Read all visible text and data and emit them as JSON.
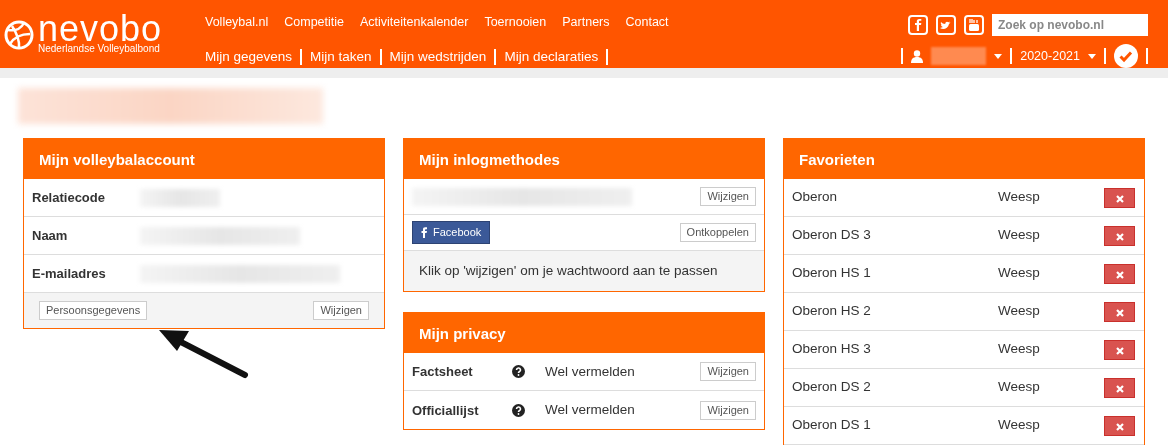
{
  "header": {
    "logo": {
      "name": "nevobo",
      "tagline": "Nederlandse Volleybalbond"
    },
    "main_nav": [
      "Volleybal.nl",
      "Competitie",
      "Activiteitenkalender",
      "Toernooien",
      "Partners",
      "Contact"
    ],
    "sub_nav": [
      "Mijn gegevens",
      "Mijn taken",
      "Mijn wedstrijden",
      "Mijn declaraties"
    ],
    "search": {
      "placeholder": "Zoek op nevobo.nl"
    },
    "season": "2020-2021"
  },
  "account": {
    "title": "Mijn volleybalaccount",
    "rows": [
      {
        "label": "Relatiecode"
      },
      {
        "label": "Naam"
      },
      {
        "label": "E-mailadres"
      }
    ],
    "buttons": [
      "Persoonsgegevens",
      "Wijzigen"
    ]
  },
  "login": {
    "title": "Mijn inlogmethodes",
    "rows": [
      {
        "kind": "password",
        "button": "Wijzigen"
      },
      {
        "kind": "facebook",
        "label": "Facebook",
        "button": "Ontkoppelen"
      }
    ],
    "note": "Klik op 'wijzigen' om je wachtwoord aan te passen"
  },
  "privacy": {
    "title": "Mijn privacy",
    "rows": [
      {
        "label": "Factsheet",
        "value": "Wel vermelden",
        "button": "Wijzigen"
      },
      {
        "label": "Officiallijst",
        "value": "Wel vermelden",
        "button": "Wijzigen"
      }
    ]
  },
  "favorites": {
    "title": "Favorieten",
    "rows": [
      {
        "team": "Oberon",
        "place": "Weesp"
      },
      {
        "team": "Oberon DS 3",
        "place": "Weesp"
      },
      {
        "team": "Oberon HS 1",
        "place": "Weesp"
      },
      {
        "team": "Oberon HS 2",
        "place": "Weesp"
      },
      {
        "team": "Oberon HS 3",
        "place": "Weesp"
      },
      {
        "team": "Oberon DS 2",
        "place": "Weesp"
      },
      {
        "team": "Oberon DS 1",
        "place": "Weesp"
      }
    ]
  }
}
